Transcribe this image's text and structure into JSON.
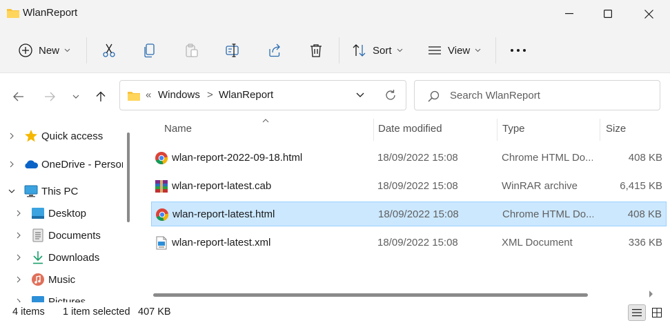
{
  "window": {
    "title": "WlanReport"
  },
  "toolbar": {
    "new_label": "New",
    "sort_label": "Sort",
    "view_label": "View"
  },
  "address": {
    "overflow": "«",
    "crumb1": "Windows",
    "separator": ">",
    "crumb2": "WlanReport"
  },
  "search": {
    "placeholder": "Search WlanReport"
  },
  "sidebar": {
    "items": [
      {
        "label": "Quick access"
      },
      {
        "label": "OneDrive - Person"
      },
      {
        "label": "This PC"
      },
      {
        "label": "Desktop"
      },
      {
        "label": "Documents"
      },
      {
        "label": "Downloads"
      },
      {
        "label": "Music"
      },
      {
        "label": "Pictures"
      }
    ]
  },
  "columns": {
    "name": "Name",
    "date": "Date modified",
    "type": "Type",
    "size": "Size"
  },
  "files": [
    {
      "name": "wlan-report-2022-09-18.html",
      "date": "18/09/2022 15:08",
      "type": "Chrome HTML Do...",
      "size": "408 KB",
      "icon": "chrome-icon"
    },
    {
      "name": "wlan-report-latest.cab",
      "date": "18/09/2022 15:08",
      "type": "WinRAR archive",
      "size": "6,415 KB",
      "icon": "winrar-icon"
    },
    {
      "name": "wlan-report-latest.html",
      "date": "18/09/2022 15:08",
      "type": "Chrome HTML Do...",
      "size": "408 KB",
      "icon": "chrome-icon",
      "selected": true
    },
    {
      "name": "wlan-report-latest.xml",
      "date": "18/09/2022 15:08",
      "type": "XML Document",
      "size": "336 KB",
      "icon": "xml-icon"
    }
  ],
  "status": {
    "count": "4 items",
    "selection": "1 item selected",
    "size": "407 KB"
  },
  "colors": {
    "selection_bg": "#cce8ff",
    "selection_border": "#99d1ff",
    "accent": "#0067c0"
  }
}
